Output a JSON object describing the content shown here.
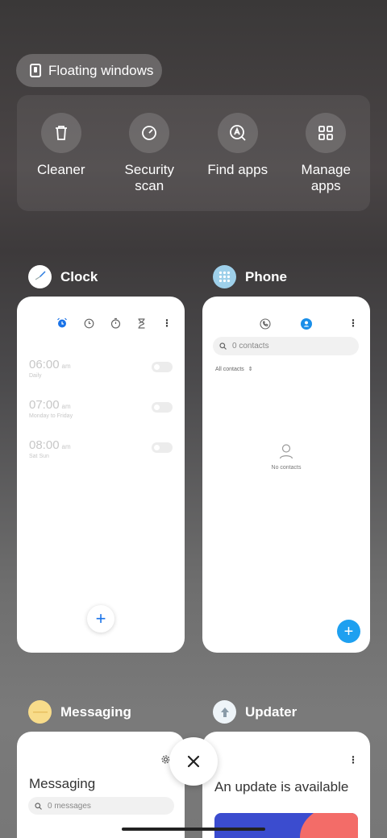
{
  "floating_windows": {
    "label": "Floating windows",
    "icon": "floating-window-icon"
  },
  "quick_actions": [
    {
      "label": "Cleaner",
      "icon": "trash-icon"
    },
    {
      "label": "Security\nscan",
      "icon": "security-scan-icon"
    },
    {
      "label": "Find apps",
      "icon": "find-apps-icon"
    },
    {
      "label": "Manage\napps",
      "icon": "grid-icon"
    }
  ],
  "apps": {
    "clock": {
      "name": "Clock",
      "alarms": [
        {
          "time": "06:00",
          "ampm": "am",
          "repeat": "Daily"
        },
        {
          "time": "07:00",
          "ampm": "am",
          "repeat": "Monday to Friday"
        },
        {
          "time": "08:00",
          "ampm": "am",
          "repeat": "Sat Sun"
        }
      ],
      "add_label": "+"
    },
    "phone": {
      "name": "Phone",
      "search_placeholder": "0 contacts",
      "filter_label": "All contacts",
      "empty_text": "No contacts",
      "add_label": "+"
    },
    "messaging": {
      "name": "Messaging",
      "title": "Messaging",
      "search_placeholder": "0 messages"
    },
    "updater": {
      "name": "Updater",
      "title": "An update is available"
    }
  },
  "colors": {
    "accent_blue": "#1ea0f0",
    "clock_icon_bg": "#ffffff",
    "phone_icon_bg": "#9ed0ea",
    "messaging_icon_bg": "#f8dc8a",
    "updater_icon_bg": "#eef4f8"
  }
}
